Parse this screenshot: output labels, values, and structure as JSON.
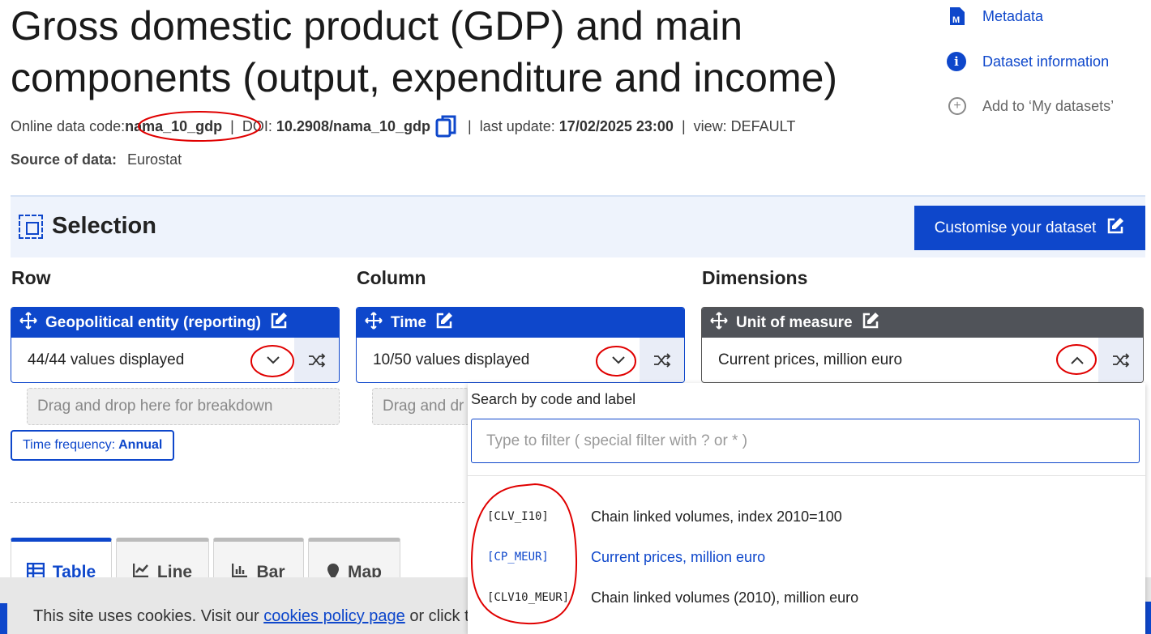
{
  "page": {
    "title": "Gross domestic product (GDP) and main components (output, expenditure and income)"
  },
  "side_links": [
    {
      "label": "Metadata",
      "icon": "metadata-icon"
    },
    {
      "label": "Dataset information",
      "icon": "info-icon"
    },
    {
      "label": "Add to ‘My datasets’",
      "icon": "add-circle-icon"
    }
  ],
  "meta": {
    "code_label": "Online data code:",
    "code": "nama_10_gdp",
    "doi_label": "DOI:",
    "doi": "10.2908/nama_10_gdp",
    "update_label": "last update:",
    "update": "17/02/2025 23:00",
    "view": "view: DEFAULT",
    "source_label": "Source of data:",
    "source": "Eurostat"
  },
  "selection": {
    "title": "Selection",
    "customise_label": "Customise your dataset"
  },
  "columns": {
    "row": "Row",
    "column": "Column",
    "dimensions": "Dimensions"
  },
  "cards": {
    "geo": {
      "title": "Geopolitical entity (reporting)",
      "value": "44/44 values displayed"
    },
    "time": {
      "title": "Time",
      "value": "10/50 values displayed"
    },
    "unit": {
      "title": "Unit of measure",
      "value": "Current prices, million euro"
    }
  },
  "dropzone": {
    "full": "Drag and drop here for breakdown",
    "partial": "Drag and dr"
  },
  "frequency": {
    "label": "Time frequency:",
    "value": "Annual"
  },
  "tabs": [
    "Table",
    "Line",
    "Bar",
    "Map"
  ],
  "dropdown": {
    "search_label": "Search by code and label",
    "placeholder": "Type to filter ( special filter with ? or * )",
    "options": [
      {
        "code": "[CLV_I10]",
        "label": "Chain linked volumes, index 2010=100"
      },
      {
        "code": "[CP_MEUR]",
        "label": "Current prices, million euro"
      },
      {
        "code": "[CLV10_MEUR]",
        "label": "Chain linked volumes (2010), million euro"
      }
    ]
  },
  "cookie": {
    "text_before": "This site uses cookies. Visit our",
    "link": "cookies policy page",
    "text_after": "or click t"
  },
  "colors": {
    "accent": "#0e47cb",
    "dark_header": "#505359",
    "annotation": "#e00000"
  }
}
